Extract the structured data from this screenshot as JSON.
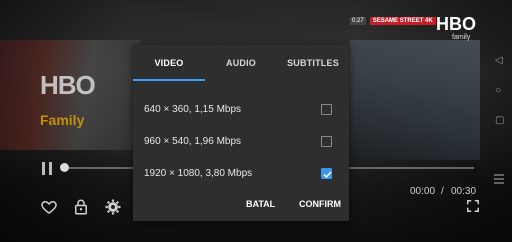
{
  "background": {
    "hbo_logo": "HBO",
    "family_logo": "Family",
    "channel_time": "0:27",
    "channel_show": "SESAME STREET 4K",
    "hbo_top": "HBO",
    "hbo_top_sub": "family"
  },
  "player": {
    "time_current": "00:00",
    "time_separator": "/",
    "time_duration": "00:30",
    "progress": 0.0
  },
  "dialog": {
    "tabs": [
      {
        "label": "VIDEO",
        "active": true
      },
      {
        "label": "AUDIO",
        "active": false
      },
      {
        "label": "SUBTITLES",
        "active": false
      }
    ],
    "options": [
      {
        "label": "640 × 360, 1,15 Mbps",
        "checked": false
      },
      {
        "label": "960 × 540, 1,96 Mbps",
        "checked": false
      },
      {
        "label": "1920 × 1080, 3,80 Mbps",
        "checked": true
      }
    ],
    "cancel_label": "BATAL",
    "confirm_label": "CONFIRM"
  },
  "colors": {
    "accent": "#38a0ff",
    "dialog_bg": "#2e2e2e"
  },
  "icons": {
    "pause": "pause-icon",
    "favorite": "heart-icon",
    "lock": "lock-icon",
    "settings": "gear-icon",
    "fullscreen": "fullscreen-icon",
    "menu": "menu-icon"
  }
}
